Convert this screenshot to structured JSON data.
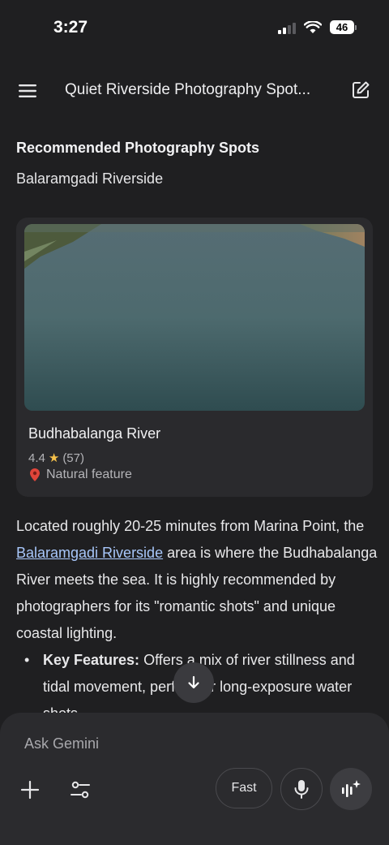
{
  "status_bar": {
    "time": "3:27",
    "battery": "46"
  },
  "header": {
    "title": "Quiet Riverside Photography Spot..."
  },
  "content": {
    "heading": "Recommended Photography Spots",
    "subheading": "Balaramgadi Riverside",
    "place_card": {
      "name": "Budhabalanga River",
      "rating": "4.4",
      "review_count": "(57)",
      "type": "Natural feature"
    },
    "paragraph": {
      "before_link": "Located roughly 20-25 minutes from Marina Point, the ",
      "link": "Balaramgadi Riverside",
      "after_link": " area is where the Budhabalanga River meets the sea. It is highly recommended by photographers for its \"romantic shots\" and unique coastal lighting."
    },
    "bullet": {
      "label": "Key Features:",
      "text": " Offers a mix of river stillness and tidal movement, perfect for long-exposure water shots."
    }
  },
  "composer": {
    "placeholder": "Ask Gemini",
    "mode_label": "Fast"
  },
  "icons": {
    "menu": "hamburger-icon",
    "edit": "new-chat-edit-icon",
    "pin": "location-pin-icon",
    "star": "star-icon",
    "scroll": "arrow-down-icon",
    "plus": "plus-icon",
    "tools": "tools-sliders-icon",
    "mic": "microphone-icon",
    "live": "sparkle-waveform-icon"
  },
  "colors": {
    "background": "#1f1f21",
    "card": "#2a2a2d",
    "link": "#a8c7fa",
    "star": "#f6c14a"
  }
}
